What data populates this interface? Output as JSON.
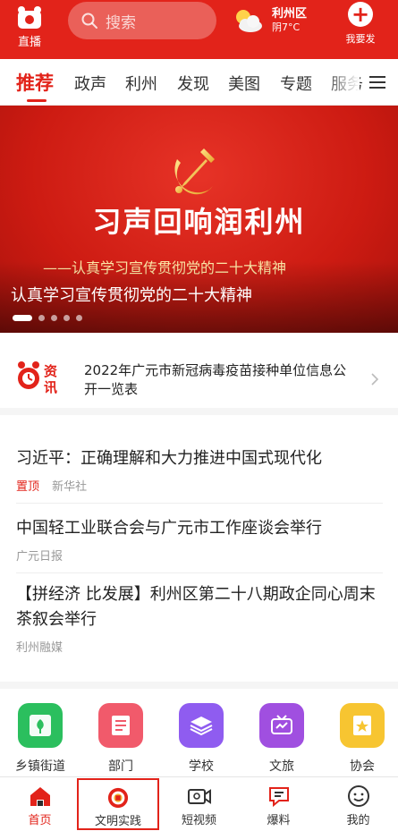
{
  "header": {
    "live_label": "直播",
    "search_placeholder": "搜索",
    "weather_district": "利州区",
    "weather_condition": "阴7°C",
    "report_label": "我要发",
    "brand_color": "#e2231a"
  },
  "tabs": [
    {
      "label": "推荐",
      "active": true
    },
    {
      "label": "政声"
    },
    {
      "label": "利州"
    },
    {
      "label": "发现"
    },
    {
      "label": "美图"
    },
    {
      "label": "专题"
    },
    {
      "label": "服务"
    }
  ],
  "banner": {
    "headline": "习声回响润利州",
    "subtitle": "——认真学习宣传贯彻党的二十大精神",
    "caption": "认真学习宣传贯彻党的二十大精神",
    "slide_count": 5,
    "active_slide": 1
  },
  "ticker": {
    "logo_text": "资讯",
    "text": "2022年广元市新冠病毒疫苗接种单位信息公开一览表"
  },
  "news": [
    {
      "title": "习近平：正确理解和大力推进中国式现代化",
      "pinned": "置顶",
      "source": "新华社"
    },
    {
      "title": "中国轻工业联合会与广元市工作座谈会举行",
      "pinned": "",
      "source": "广元日报"
    },
    {
      "title": "【拼经济 比发展】利州区第二十八期政企同心周末茶叙会举行",
      "pinned": "",
      "source": "利州融媒"
    }
  ],
  "services": [
    {
      "label": "乡镇街道",
      "icon": "town-icon",
      "color": "#2bbf5e"
    },
    {
      "label": "部门",
      "icon": "department-icon",
      "color": "#f15a6b"
    },
    {
      "label": "学校",
      "icon": "school-icon",
      "color": "#8f5cf0"
    },
    {
      "label": "文旅",
      "icon": "tourism-icon",
      "color": "#a04fe0"
    },
    {
      "label": "协会",
      "icon": "association-icon",
      "color": "#f7c531"
    }
  ],
  "bottom_nav": [
    {
      "label": "首页",
      "icon": "home-icon",
      "active": true
    },
    {
      "label": "文明实践",
      "icon": "civilization-icon"
    },
    {
      "label": "短视频",
      "icon": "video-icon"
    },
    {
      "label": "爆料",
      "icon": "tipoff-icon"
    },
    {
      "label": "我的",
      "icon": "profile-icon"
    }
  ]
}
